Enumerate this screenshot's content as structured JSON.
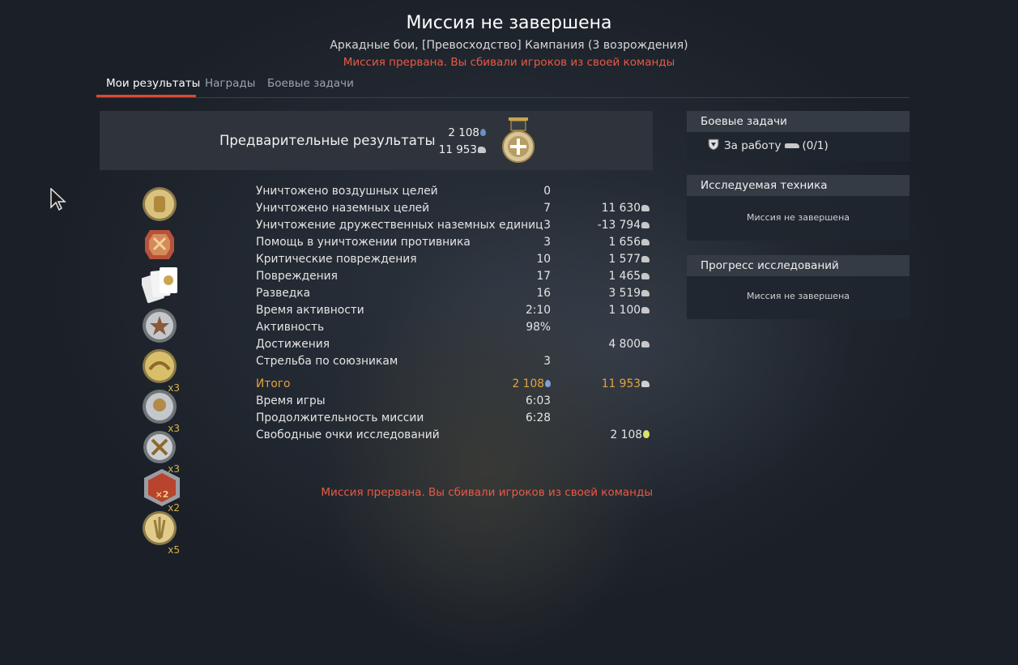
{
  "header": {
    "title": "Миссия не завершена",
    "subtitle": "Аркадные бои, [Превосходство] Кампания (3 возрождения)",
    "warning": "Миссия прервана. Вы сбивали игроков из своей команды"
  },
  "tabs": [
    {
      "label": "Мои результаты",
      "active": true
    },
    {
      "label": "Награды",
      "active": false
    },
    {
      "label": "Боевые задачи",
      "active": false
    }
  ],
  "preliminary": {
    "label": "Предварительные результаты",
    "rp": "2 108",
    "sl": "11 953",
    "medal_icon": "medal-icon"
  },
  "awards": [
    {
      "icon": "gold-award-icon",
      "multiplier": ""
    },
    {
      "icon": "red-award-icon",
      "multiplier": ""
    },
    {
      "icon": "cards-award-icon",
      "multiplier": ""
    },
    {
      "icon": "silver-star-award-icon",
      "multiplier": ""
    },
    {
      "icon": "gold-wings-award-icon",
      "multiplier": "x3"
    },
    {
      "icon": "silver-explosion-award-icon",
      "multiplier": "x3"
    },
    {
      "icon": "crossed-swords-award-icon",
      "multiplier": "x3"
    },
    {
      "icon": "red-x2-award-icon",
      "multiplier": "x2"
    },
    {
      "icon": "gold-feathers-award-icon",
      "multiplier": "x5"
    }
  ],
  "stats": [
    {
      "label": "Уничтожено воздушных целей",
      "v1": "0",
      "v2": "",
      "v2_icon": ""
    },
    {
      "label": "Уничтожено наземных целей",
      "v1": "7",
      "v2": "11 630",
      "v2_icon": "sl"
    },
    {
      "label": "Уничтожение дружественных наземных единиц",
      "v1": "3",
      "v2": "-13 794",
      "v2_icon": "sl"
    },
    {
      "label": "Помощь в уничтожении противника",
      "v1": "3",
      "v2": "1 656",
      "v2_icon": "sl"
    },
    {
      "label": "Критические повреждения",
      "v1": "10",
      "v2": "1 577",
      "v2_icon": "sl"
    },
    {
      "label": "Повреждения",
      "v1": "17",
      "v2": "1 465",
      "v2_icon": "sl"
    },
    {
      "label": "Разведка",
      "v1": "16",
      "v2": "3 519",
      "v2_icon": "sl"
    },
    {
      "label": "Время активности",
      "v1": "2:10",
      "v2": "1 100",
      "v2_icon": "sl"
    },
    {
      "label": "Активность",
      "v1": "98%",
      "v2": "",
      "v2_icon": ""
    },
    {
      "label": "Достижения",
      "v1": "",
      "v2": "4 800",
      "v2_icon": "sl"
    },
    {
      "label": "Стрельба по союзникам",
      "v1": "3",
      "v2": "",
      "v2_icon": ""
    }
  ],
  "totals": [
    {
      "label": "Итого",
      "v1": "2 108",
      "v1_icon": "rp",
      "v2": "11 953",
      "v2_icon": "sl"
    },
    {
      "label": "Время игры",
      "v1": "6:03",
      "v1_icon": "",
      "v2": "",
      "v2_icon": ""
    },
    {
      "label": "Продолжительность миссии",
      "v1": "6:28",
      "v1_icon": "",
      "v2": "",
      "v2_icon": ""
    },
    {
      "label": "Свободные очки исследований",
      "v1": "",
      "v1_icon": "",
      "v2": "2 108",
      "v2_icon": "bulb"
    }
  ],
  "footer_warning": "Миссия прервана. Вы сбивали игроков из своей команды",
  "panels": {
    "tasks": {
      "title": "Боевые задачи",
      "item": "За работу",
      "progress": "(0/1)"
    },
    "research_vehicle": {
      "title": "Исследуемая техника",
      "note": "Миссия не завершена"
    },
    "research_progress": {
      "title": "Прогресс исследований",
      "note": "Миссия не завершена"
    }
  },
  "colors": {
    "accent_red": "#d84a33",
    "warning_text": "#e85a45",
    "gold_text": "#e0a441",
    "panel_header": "#353b44",
    "rp_icon": "#6b8fc7",
    "bulb_icon": "#d8e36a"
  }
}
